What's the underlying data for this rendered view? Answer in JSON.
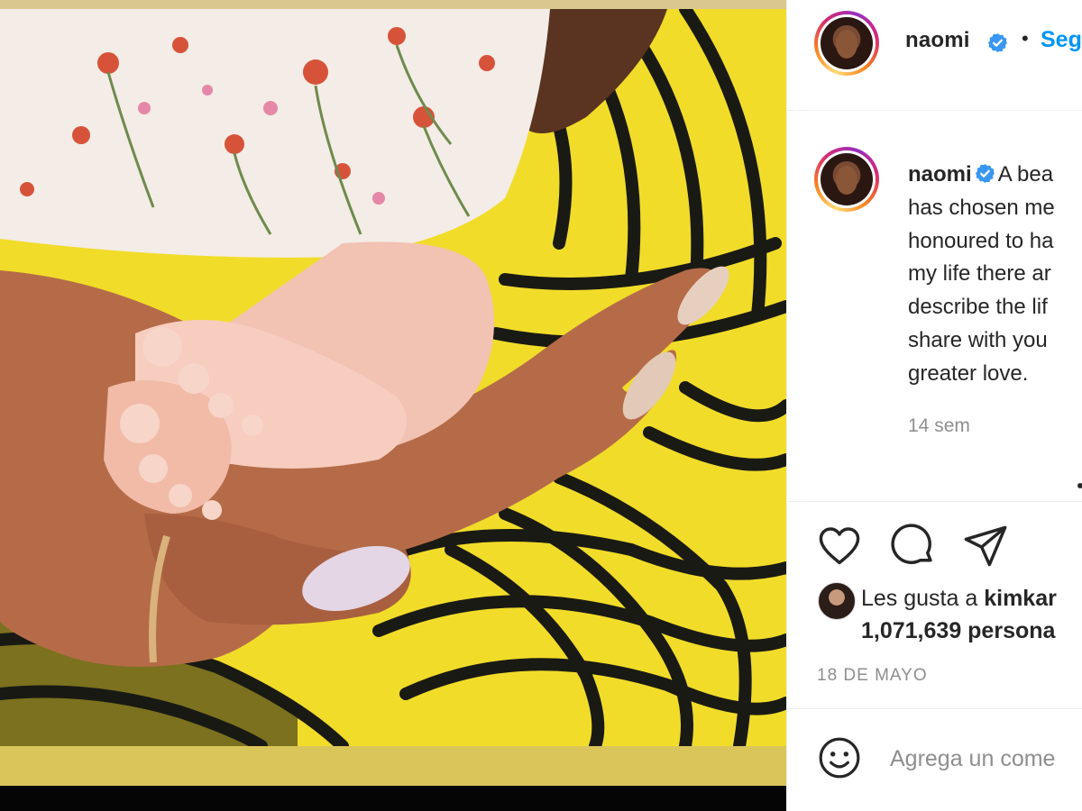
{
  "post": {
    "username": "naomi",
    "verified": true,
    "separator": "•",
    "follow_label": "Seg"
  },
  "caption": {
    "username": "naomi",
    "text_lines": [
      "A bea",
      "has chosen me",
      "honoured to ha",
      "my life there ar",
      "describe the lif",
      "share with you",
      "greater love."
    ],
    "time_ago": "14 sem"
  },
  "likes": {
    "prefix": "Les gusta a ",
    "liker": "kimkar",
    "count_text": "1,071,639 persona"
  },
  "date": "18 DE MAYO",
  "comment": {
    "placeholder": "Agrega un come"
  },
  "colors": {
    "link_blue": "#0095f6",
    "verified_blue": "#3897f0",
    "muted_gray": "#8e8e8e",
    "text_dark": "#262626",
    "image_yellow": "#f1dc2a"
  },
  "icons": {
    "like": "heart-outline-icon",
    "comment": "speech-bubble-icon",
    "share": "paper-plane-icon",
    "emoji": "smiley-icon",
    "verified": "verified-badge-icon"
  }
}
